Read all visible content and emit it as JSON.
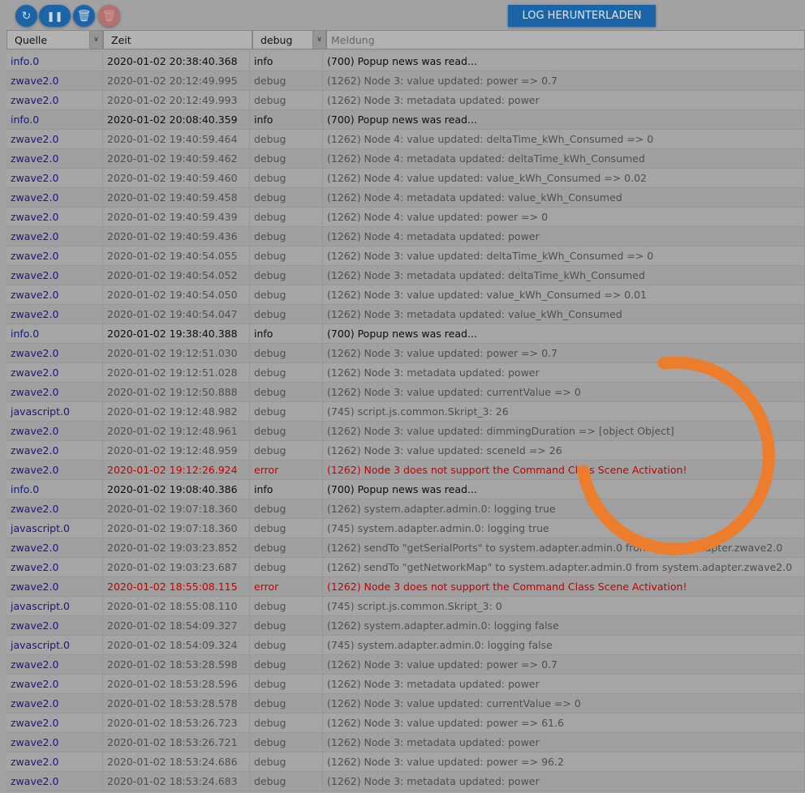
{
  "toolbar": {
    "download_label": "LOG HERUNTERLADEN"
  },
  "header": {
    "source": "Quelle",
    "time": "Zeit",
    "level": "debug",
    "message_placeholder": "Meldung"
  },
  "colors": {
    "accent": "#1c64a8",
    "spinner": "#ec7d2d",
    "error": "#c40000"
  },
  "rows": [
    [
      "info.0",
      "2020-01-02 20:38:40.368",
      "info",
      "(700) Popup news was read..."
    ],
    [
      "zwave2.0",
      "2020-01-02 20:12:49.995",
      "debug",
      "(1262) Node 3: value updated: power => 0.7"
    ],
    [
      "zwave2.0",
      "2020-01-02 20:12:49.993",
      "debug",
      "(1262) Node 3: metadata updated: power"
    ],
    [
      "info.0",
      "2020-01-02 20:08:40.359",
      "info",
      "(700) Popup news was read..."
    ],
    [
      "zwave2.0",
      "2020-01-02 19:40:59.464",
      "debug",
      "(1262) Node 4: value updated: deltaTime_kWh_Consumed => 0"
    ],
    [
      "zwave2.0",
      "2020-01-02 19:40:59.462",
      "debug",
      "(1262) Node 4: metadata updated: deltaTime_kWh_Consumed"
    ],
    [
      "zwave2.0",
      "2020-01-02 19:40:59.460",
      "debug",
      "(1262) Node 4: value updated: value_kWh_Consumed => 0.02"
    ],
    [
      "zwave2.0",
      "2020-01-02 19:40:59.458",
      "debug",
      "(1262) Node 4: metadata updated: value_kWh_Consumed"
    ],
    [
      "zwave2.0",
      "2020-01-02 19:40:59.439",
      "debug",
      "(1262) Node 4: value updated: power => 0"
    ],
    [
      "zwave2.0",
      "2020-01-02 19:40:59.436",
      "debug",
      "(1262) Node 4: metadata updated: power"
    ],
    [
      "zwave2.0",
      "2020-01-02 19:40:54.055",
      "debug",
      "(1262) Node 3: value updated: deltaTime_kWh_Consumed => 0"
    ],
    [
      "zwave2.0",
      "2020-01-02 19:40:54.052",
      "debug",
      "(1262) Node 3: metadata updated: deltaTime_kWh_Consumed"
    ],
    [
      "zwave2.0",
      "2020-01-02 19:40:54.050",
      "debug",
      "(1262) Node 3: value updated: value_kWh_Consumed => 0.01"
    ],
    [
      "zwave2.0",
      "2020-01-02 19:40:54.047",
      "debug",
      "(1262) Node 3: metadata updated: value_kWh_Consumed"
    ],
    [
      "info.0",
      "2020-01-02 19:38:40.388",
      "info",
      "(700) Popup news was read..."
    ],
    [
      "zwave2.0",
      "2020-01-02 19:12:51.030",
      "debug",
      "(1262) Node 3: value updated: power => 0.7"
    ],
    [
      "zwave2.0",
      "2020-01-02 19:12:51.028",
      "debug",
      "(1262) Node 3: metadata updated: power"
    ],
    [
      "zwave2.0",
      "2020-01-02 19:12:50.888",
      "debug",
      "(1262) Node 3: value updated: currentValue => 0"
    ],
    [
      "javascript.0",
      "2020-01-02 19:12:48.982",
      "debug",
      "(745) script.js.common.Skript_3: 26"
    ],
    [
      "zwave2.0",
      "2020-01-02 19:12:48.961",
      "debug",
      "(1262) Node 3: value updated: dimmingDuration => [object Object]"
    ],
    [
      "zwave2.0",
      "2020-01-02 19:12:48.959",
      "debug",
      "(1262) Node 3: value updated: sceneId => 26"
    ],
    [
      "zwave2.0",
      "2020-01-02 19:12:26.924",
      "error",
      "(1262) Node 3 does not support the Command Class Scene Activation!"
    ],
    [
      "info.0",
      "2020-01-02 19:08:40.386",
      "info",
      "(700) Popup news was read..."
    ],
    [
      "zwave2.0",
      "2020-01-02 19:07:18.360",
      "debug",
      "(1262) system.adapter.admin.0: logging true"
    ],
    [
      "javascript.0",
      "2020-01-02 19:07:18.360",
      "debug",
      "(745) system.adapter.admin.0: logging true"
    ],
    [
      "zwave2.0",
      "2020-01-02 19:03:23.852",
      "debug",
      "(1262) sendTo \"getSerialPorts\" to system.adapter.admin.0 from system.adapter.zwave2.0"
    ],
    [
      "zwave2.0",
      "2020-01-02 19:03:23.687",
      "debug",
      "(1262) sendTo \"getNetworkMap\" to system.adapter.admin.0 from system.adapter.zwave2.0"
    ],
    [
      "zwave2.0",
      "2020-01-02 18:55:08.115",
      "error",
      "(1262) Node 3 does not support the Command Class Scene Activation!"
    ],
    [
      "javascript.0",
      "2020-01-02 18:55:08.110",
      "debug",
      "(745) script.js.common.Skript_3: 0"
    ],
    [
      "zwave2.0",
      "2020-01-02 18:54:09.327",
      "debug",
      "(1262) system.adapter.admin.0: logging false"
    ],
    [
      "javascript.0",
      "2020-01-02 18:54:09.324",
      "debug",
      "(745) system.adapter.admin.0: logging false"
    ],
    [
      "zwave2.0",
      "2020-01-02 18:53:28.598",
      "debug",
      "(1262) Node 3: value updated: power => 0.7"
    ],
    [
      "zwave2.0",
      "2020-01-02 18:53:28.596",
      "debug",
      "(1262) Node 3: metadata updated: power"
    ],
    [
      "zwave2.0",
      "2020-01-02 18:53:28.578",
      "debug",
      "(1262) Node 3: value updated: currentValue => 0"
    ],
    [
      "zwave2.0",
      "2020-01-02 18:53:26.723",
      "debug",
      "(1262) Node 3: value updated: power => 61.6"
    ],
    [
      "zwave2.0",
      "2020-01-02 18:53:26.721",
      "debug",
      "(1262) Node 3: metadata updated: power"
    ],
    [
      "zwave2.0",
      "2020-01-02 18:53:24.686",
      "debug",
      "(1262) Node 3: value updated: power => 96.2"
    ],
    [
      "zwave2.0",
      "2020-01-02 18:53:24.683",
      "debug",
      "(1262) Node 3: metadata updated: power"
    ]
  ]
}
